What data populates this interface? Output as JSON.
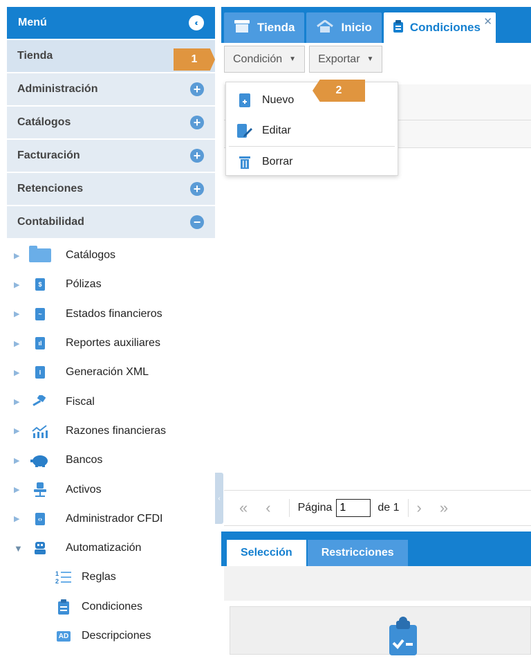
{
  "sidebar": {
    "title": "Menú",
    "sections": [
      {
        "label": "Tienda",
        "icon": "none"
      },
      {
        "label": "Administración",
        "icon": "plus-icon"
      },
      {
        "label": "Catálogos",
        "icon": "plus-icon"
      },
      {
        "label": "Facturación",
        "icon": "plus-icon"
      },
      {
        "label": "Retenciones",
        "icon": "plus-icon"
      },
      {
        "label": "Contabilidad",
        "icon": "minus-icon"
      }
    ],
    "tree": [
      {
        "label": "Catálogos",
        "icon": "folder-icon"
      },
      {
        "label": "Pólizas",
        "icon": "document-dollar-icon"
      },
      {
        "label": "Estados financieros",
        "icon": "document-chart-icon"
      },
      {
        "label": "Reportes auxiliares",
        "icon": "document-bars-icon"
      },
      {
        "label": "Generación XML",
        "icon": "document-xml-icon"
      },
      {
        "label": "Fiscal",
        "icon": "gavel-icon"
      },
      {
        "label": "Razones financieras",
        "icon": "trend-chart-icon"
      },
      {
        "label": "Bancos",
        "icon": "piggy-bank-icon"
      },
      {
        "label": "Activos",
        "icon": "chair-icon"
      },
      {
        "label": "Administrador CFDI",
        "icon": "document-code-icon"
      },
      {
        "label": "Automatización",
        "icon": "robot-icon"
      }
    ],
    "automation_children": [
      {
        "label": "Reglas",
        "icon": "numbered-list-icon"
      },
      {
        "label": "Condiciones",
        "icon": "clipboard-icon"
      },
      {
        "label": "Descripciones",
        "icon": "ad-badge-icon",
        "badge_text": "AD"
      }
    ]
  },
  "tabs": [
    {
      "label": "Tienda",
      "icon": "store-icon"
    },
    {
      "label": "Inicio",
      "icon": "home-icon"
    },
    {
      "label": "Condiciones",
      "icon": "clipboard-icon",
      "active": true
    }
  ],
  "toolbar": {
    "condition_label": "Condición",
    "export_label": "Exportar"
  },
  "dropdown": {
    "items": [
      {
        "label": "Nuevo",
        "icon": "new-document-icon"
      },
      {
        "label": "Editar",
        "icon": "edit-document-icon"
      },
      {
        "label": "Borrar",
        "icon": "trash-icon"
      }
    ]
  },
  "pager": {
    "page_label": "Página",
    "page_value": "1",
    "of_label": "de 1"
  },
  "subtabs": [
    {
      "label": "Selección",
      "active": true
    },
    {
      "label": "Restricciones",
      "active": false
    }
  ],
  "steps": {
    "step1": "1",
    "step2": "2"
  },
  "colors": {
    "primary": "#1580d0",
    "tab_inactive": "#4c9be0",
    "section_bg": "#e3ebf3",
    "step_badge": "#e0953f"
  }
}
